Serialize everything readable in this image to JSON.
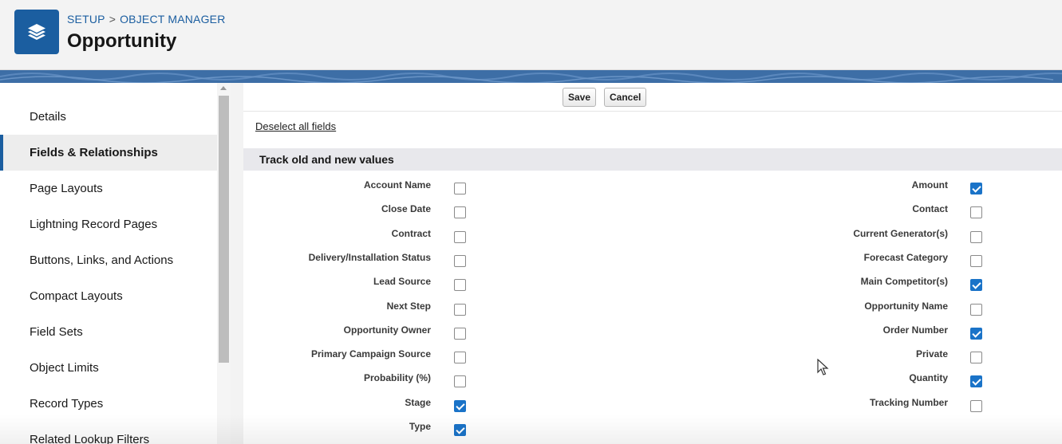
{
  "header": {
    "breadcrumb": [
      "SETUP",
      "OBJECT MANAGER"
    ],
    "breadcrumb_separator": ">",
    "title": "Opportunity"
  },
  "sidebar": {
    "items": [
      {
        "label": "Details",
        "active": false
      },
      {
        "label": "Fields & Relationships",
        "active": true
      },
      {
        "label": "Page Layouts",
        "active": false
      },
      {
        "label": "Lightning Record Pages",
        "active": false
      },
      {
        "label": "Buttons, Links, and Actions",
        "active": false
      },
      {
        "label": "Compact Layouts",
        "active": false
      },
      {
        "label": "Field Sets",
        "active": false
      },
      {
        "label": "Object Limits",
        "active": false
      },
      {
        "label": "Record Types",
        "active": false
      },
      {
        "label": "Related Lookup Filters",
        "active": false
      }
    ]
  },
  "toolbar": {
    "save_label": "Save",
    "cancel_label": "Cancel"
  },
  "deselect_label": "Deselect all fields",
  "section_title": "Track old and new values",
  "fields_left": [
    {
      "label": "Account Name",
      "checked": false
    },
    {
      "label": "Close Date",
      "checked": false
    },
    {
      "label": "Contract",
      "checked": false
    },
    {
      "label": "Delivery/Installation Status",
      "checked": false
    },
    {
      "label": "Lead Source",
      "checked": false
    },
    {
      "label": "Next Step",
      "checked": false
    },
    {
      "label": "Opportunity Owner",
      "checked": false
    },
    {
      "label": "Primary Campaign Source",
      "checked": false
    },
    {
      "label": "Probability (%)",
      "checked": false
    },
    {
      "label": "Stage",
      "checked": true
    },
    {
      "label": "Type",
      "checked": true
    }
  ],
  "fields_right": [
    {
      "label": "Amount",
      "checked": true
    },
    {
      "label": "Contact",
      "checked": false
    },
    {
      "label": "Current Generator(s)",
      "checked": false
    },
    {
      "label": "Forecast Category",
      "checked": false
    },
    {
      "label": "Main Competitor(s)",
      "checked": true
    },
    {
      "label": "Opportunity Name",
      "checked": false
    },
    {
      "label": "Order Number",
      "checked": true
    },
    {
      "label": "Private",
      "checked": false
    },
    {
      "label": "Quantity",
      "checked": true
    },
    {
      "label": "Tracking Number",
      "checked": false
    }
  ],
  "icons": {
    "logo": "layers-icon",
    "cursor": "mouse-pointer-icon"
  },
  "colors": {
    "accent": "#1b5ea0",
    "checkbox_checked": "#1a73c8",
    "band": "#3d6ea6"
  }
}
